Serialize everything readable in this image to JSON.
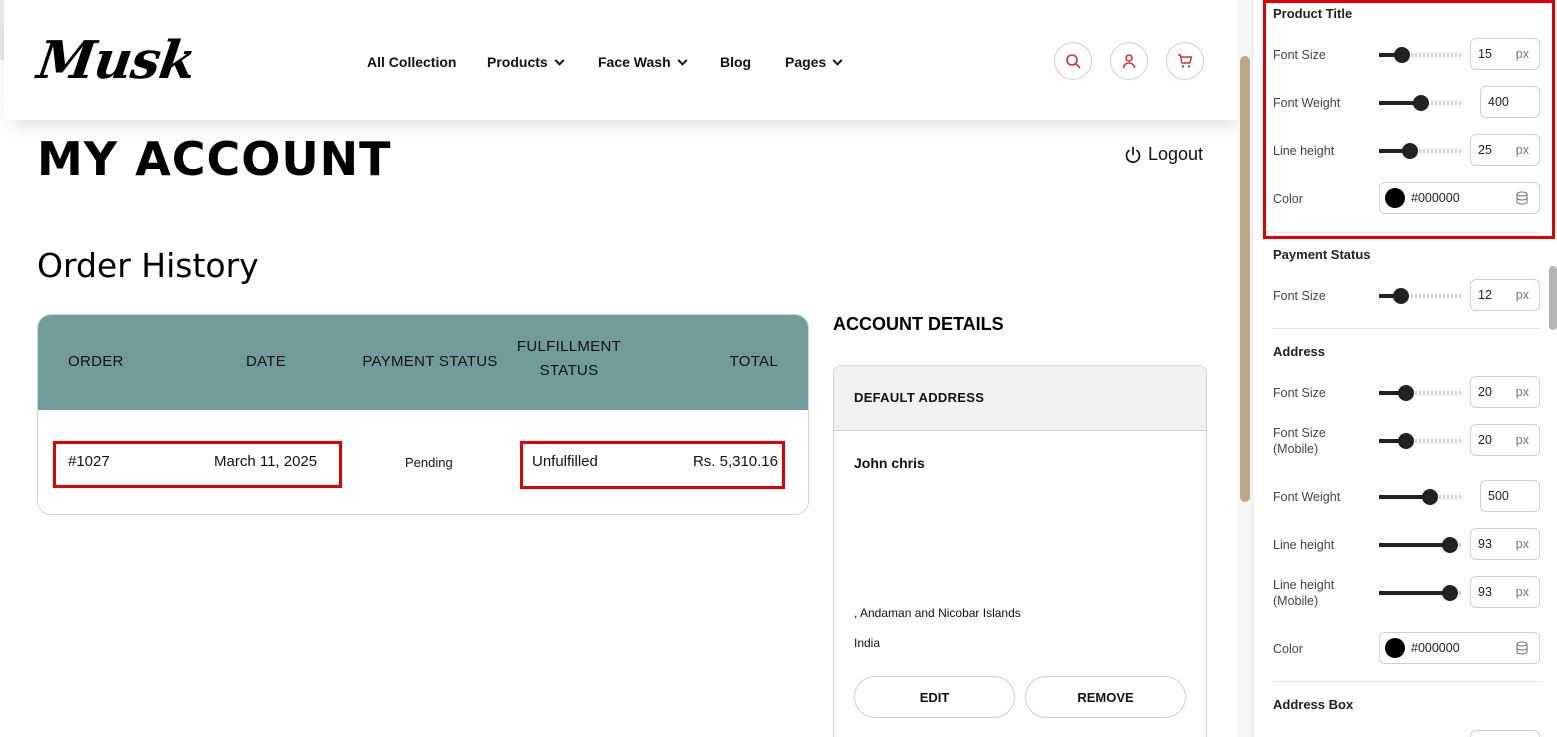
{
  "brand": {
    "logo_text": "Musk"
  },
  "nav": {
    "items": [
      {
        "label": "All Collection"
      },
      {
        "label": "Products"
      },
      {
        "label": "Face Wash"
      },
      {
        "label": "Blog"
      },
      {
        "label": "Pages"
      }
    ]
  },
  "header_icons": [
    "search-icon",
    "user-icon",
    "cart-icon"
  ],
  "account": {
    "page_title": "MY ACCOUNT",
    "logout_label": "Logout",
    "order_history_title": "Order History",
    "orders_table": {
      "headers": {
        "order": "ORDER",
        "date": "DATE",
        "payment_status": "PAYMENT STATUS",
        "fulfillment_status_line1": "FULFILLMENT",
        "fulfillment_status_line2": "STATUS",
        "total": "TOTAL"
      },
      "rows": [
        {
          "order": "#1027",
          "date": "March 11, 2025",
          "payment_status": "Pending",
          "fulfillment_status": "Unfulfilled",
          "total": "Rs. 5,310.16"
        }
      ]
    },
    "account_details_title": "ACCOUNT DETAILS",
    "address_card": {
      "header": "DEFAULT ADDRESS",
      "name": "John chris",
      "line": ", Andaman and Nicobar Islands",
      "country": "India",
      "edit_label": "EDIT",
      "remove_label": "REMOVE"
    }
  },
  "settings": {
    "product_title": {
      "title": "Product Title",
      "font_size": {
        "label": "Font Size",
        "value": "15",
        "unit": "px",
        "level": 0.2
      },
      "font_weight": {
        "label": "Font Weight",
        "value": "400",
        "level": 0.45
      },
      "line_height": {
        "label": "Line height",
        "value": "25",
        "unit": "px",
        "level": 0.3
      },
      "color": {
        "label": "Color",
        "value": "#000000"
      }
    },
    "payment_status": {
      "title": "Payment Status",
      "font_size": {
        "label": "Font Size",
        "value": "12",
        "unit": "px",
        "level": 0.18
      }
    },
    "address": {
      "title": "Address",
      "font_size": {
        "label": "Font Size",
        "value": "20",
        "unit": "px",
        "level": 0.25
      },
      "font_size_mobile": {
        "label_line1": "Font Size",
        "label_line2": "(Mobile)",
        "value": "20",
        "unit": "px",
        "level": 0.25
      },
      "font_weight": {
        "label": "Font Weight",
        "value": "500",
        "level": 0.57
      },
      "line_height": {
        "label": "Line height",
        "value": "93",
        "unit": "px",
        "level": 0.84
      },
      "line_height_mobile": {
        "label_line1": "Line height",
        "label_line2": "(Mobile)",
        "value": "93",
        "unit": "px",
        "level": 0.84
      },
      "color": {
        "label": "Color",
        "value": "#000000"
      }
    },
    "address_box": {
      "title": "Address Box"
    }
  },
  "colors": {
    "table_header_bg": "#719c9c",
    "highlight_red": "#e00000",
    "scroll_thumb": "#b9a988",
    "card_header_bg": "#f1f2f0"
  }
}
